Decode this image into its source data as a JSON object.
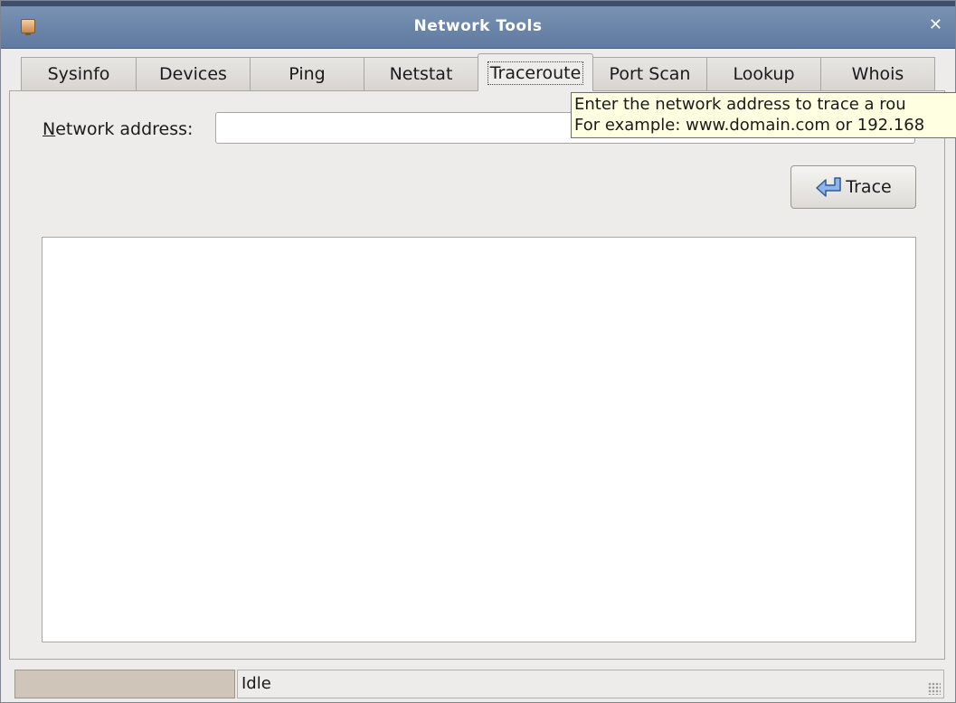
{
  "window": {
    "title": "Network Tools",
    "close_icon": "close-icon"
  },
  "tabs": [
    {
      "label": "Sysinfo",
      "active": false
    },
    {
      "label": "Devices",
      "active": false
    },
    {
      "label": "Ping",
      "active": false
    },
    {
      "label": "Netstat",
      "active": false
    },
    {
      "label": "Traceroute",
      "active": true
    },
    {
      "label": "Port Scan",
      "active": false
    },
    {
      "label": "Lookup",
      "active": false
    },
    {
      "label": "Whois",
      "active": false
    }
  ],
  "form": {
    "network_label_mnemonic": "N",
    "network_label_rest": "etwork address:",
    "network_value": ""
  },
  "tooltip": {
    "line1": "Enter the network address to trace a rou",
    "line2": "For example: www.domain.com or 192.168"
  },
  "trace_button": {
    "label": "Trace",
    "icon": "trace-arrow-icon"
  },
  "status": {
    "text": "Idle",
    "progress": 0
  },
  "colors": {
    "titlebar": "#6a84a8",
    "tooltip_bg": "#ffffe1",
    "window_bg": "#edeceb"
  }
}
